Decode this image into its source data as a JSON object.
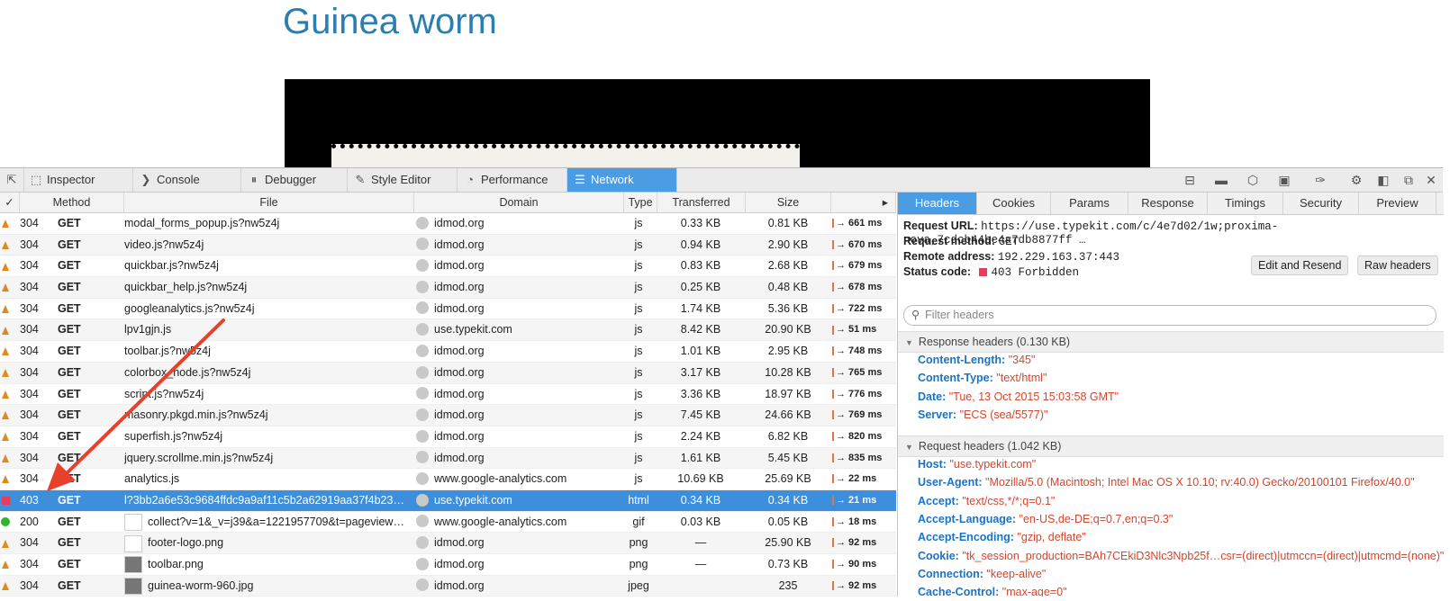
{
  "page": {
    "title": "Guinea worm"
  },
  "toolbar": {
    "tabs": [
      {
        "label": "Inspector",
        "icon": "inspector-icon",
        "glyph": "⬚"
      },
      {
        "label": "Console",
        "icon": "console-icon",
        "glyph": "❯"
      },
      {
        "label": "Debugger",
        "icon": "debugger-icon",
        "glyph": "⏸"
      },
      {
        "label": "Style Editor",
        "icon": "style-editor-icon",
        "glyph": "✎"
      },
      {
        "label": "Performance",
        "icon": "performance-icon",
        "glyph": "◔"
      },
      {
        "label": "Network",
        "icon": "network-icon",
        "glyph": "☰"
      }
    ],
    "active_tab": "Network"
  },
  "list": {
    "columns": {
      "check": "✓",
      "method": "Method",
      "file": "File",
      "domain": "Domain",
      "type": "Type",
      "transferred": "Transferred",
      "size": "Size"
    },
    "rows": [
      {
        "status": "304",
        "icon": "warn",
        "method": "GET",
        "file": "modal_forms_popup.js?nw5z4j",
        "domain": "idmod.org",
        "type": "js",
        "transferred": "0.33 KB",
        "size": "0.81 KB",
        "time": "→ 661 ms"
      },
      {
        "status": "304",
        "icon": "warn",
        "method": "GET",
        "file": "video.js?nw5z4j",
        "domain": "idmod.org",
        "type": "js",
        "transferred": "0.94 KB",
        "size": "2.90 KB",
        "time": "→ 670 ms"
      },
      {
        "status": "304",
        "icon": "warn",
        "method": "GET",
        "file": "quickbar.js?nw5z4j",
        "domain": "idmod.org",
        "type": "js",
        "transferred": "0.83 KB",
        "size": "2.68 KB",
        "time": "→ 679 ms"
      },
      {
        "status": "304",
        "icon": "warn",
        "method": "GET",
        "file": "quickbar_help.js?nw5z4j",
        "domain": "idmod.org",
        "type": "js",
        "transferred": "0.25 KB",
        "size": "0.48 KB",
        "time": "→ 678 ms"
      },
      {
        "status": "304",
        "icon": "warn",
        "method": "GET",
        "file": "googleanalytics.js?nw5z4j",
        "domain": "idmod.org",
        "type": "js",
        "transferred": "1.74 KB",
        "size": "5.36 KB",
        "time": "→ 722 ms"
      },
      {
        "status": "304",
        "icon": "warn",
        "method": "GET",
        "file": "lpv1gjn.js",
        "domain": "use.typekit.com",
        "type": "js",
        "transferred": "8.42 KB",
        "size": "20.90 KB",
        "time": "→ 51 ms"
      },
      {
        "status": "304",
        "icon": "warn",
        "method": "GET",
        "file": "toolbar.js?nw5z4j",
        "domain": "idmod.org",
        "type": "js",
        "transferred": "1.01 KB",
        "size": "2.95 KB",
        "time": "→ 748 ms"
      },
      {
        "status": "304",
        "icon": "warn",
        "method": "GET",
        "file": "colorbox_node.js?nw5z4j",
        "domain": "idmod.org",
        "type": "js",
        "transferred": "3.17 KB",
        "size": "10.28 KB",
        "time": "→ 765 ms"
      },
      {
        "status": "304",
        "icon": "warn",
        "method": "GET",
        "file": "script.js?nw5z4j",
        "domain": "idmod.org",
        "type": "js",
        "transferred": "3.36 KB",
        "size": "18.97 KB",
        "time": "→ 776 ms"
      },
      {
        "status": "304",
        "icon": "warn",
        "method": "GET",
        "file": "masonry.pkgd.min.js?nw5z4j",
        "domain": "idmod.org",
        "type": "js",
        "transferred": "7.45 KB",
        "size": "24.66 KB",
        "time": "→ 769 ms"
      },
      {
        "status": "304",
        "icon": "warn",
        "method": "GET",
        "file": "superfish.js?nw5z4j",
        "domain": "idmod.org",
        "type": "js",
        "transferred": "2.24 KB",
        "size": "6.82 KB",
        "time": "→ 820 ms"
      },
      {
        "status": "304",
        "icon": "warn",
        "method": "GET",
        "file": "jquery.scrollme.min.js?nw5z4j",
        "domain": "idmod.org",
        "type": "js",
        "transferred": "1.61 KB",
        "size": "5.45 KB",
        "time": "→ 835 ms"
      },
      {
        "status": "304",
        "icon": "warn",
        "method": "GET",
        "file": "analytics.js",
        "domain": "www.google-analytics.com",
        "type": "js",
        "transferred": "10.69 KB",
        "size": "25.69 KB",
        "time": "→ 22 ms"
      },
      {
        "status": "403",
        "icon": "error",
        "method": "GET",
        "file": "l?3bb2a6e53c9684ffdc9a9af11c5b2a62919aa37f4b23…",
        "domain": "use.typekit.com",
        "type": "html",
        "transferred": "0.34 KB",
        "size": "0.34 KB",
        "time": "→ 21 ms",
        "selected": true
      },
      {
        "status": "200",
        "icon": "ok",
        "method": "GET",
        "file": "collect?v=1&_v=j39&a=1221957709&t=pageview&_…",
        "domain": "www.google-analytics.com",
        "type": "gif",
        "transferred": "0.03 KB",
        "size": "0.05 KB",
        "time": "→ 18 ms",
        "thumb": "light"
      },
      {
        "status": "304",
        "icon": "warn",
        "method": "GET",
        "file": "footer-logo.png",
        "domain": "idmod.org",
        "type": "png",
        "transferred": "—",
        "size": "25.90 KB",
        "time": "→ 92 ms",
        "thumb": "light"
      },
      {
        "status": "304",
        "icon": "warn",
        "method": "GET",
        "file": "toolbar.png",
        "domain": "idmod.org",
        "type": "png",
        "transferred": "—",
        "size": "0.73 KB",
        "time": "→ 90 ms",
        "thumb": "dark"
      },
      {
        "status": "304",
        "icon": "warn",
        "method": "GET",
        "file": "guinea-worm-960.jpg",
        "domain": "idmod.org",
        "type": "jpeg",
        "transferred": "",
        "size": "235",
        "time": "→ 92 ms",
        "thumb": "dark"
      }
    ]
  },
  "details": {
    "tabs": [
      "Headers",
      "Cookies",
      "Params",
      "Response",
      "Timings",
      "Security",
      "Preview"
    ],
    "active_tab": "Headers",
    "request_url_label": "Request URL:",
    "request_url": "https://use.typekit.com/c/4e7d02/1w;proxima-nova,7cdcb44be4a7db8877ff …",
    "method_label": "Request method:",
    "method": "GET",
    "remote_label": "Remote address:",
    "remote": "192.229.163.37:443",
    "status_label": "Status code:",
    "status": "403 Forbidden",
    "status_color": "#e53d5a",
    "edit_resend": "Edit and Resend",
    "raw_headers": "Raw headers",
    "filter_placeholder": "Filter headers",
    "response_section": "Response headers (0.130 KB)",
    "response_headers": [
      {
        "k": "Content-Length:",
        "v": "\"345\""
      },
      {
        "k": "Content-Type:",
        "v": "\"text/html\""
      },
      {
        "k": "Date:",
        "v": "\"Tue, 13 Oct 2015 15:03:58 GMT\""
      },
      {
        "k": "Server:",
        "v": "\"ECS (sea/5577)\""
      }
    ],
    "request_section": "Request headers (1.042 KB)",
    "request_headers": [
      {
        "k": "Host:",
        "v": "\"use.typekit.com\""
      },
      {
        "k": "User-Agent:",
        "v": "\"Mozilla/5.0 (Macintosh; Intel Mac OS X 10.10; rv:40.0) Gecko/20100101 Firefox/40.0\""
      },
      {
        "k": "Accept:",
        "v": "\"text/css,*/*;q=0.1\""
      },
      {
        "k": "Accept-Language:",
        "v": "\"en-US,de-DE;q=0.7,en;q=0.3\""
      },
      {
        "k": "Accept-Encoding:",
        "v": "\"gzip, deflate\""
      },
      {
        "k": "Cookie:",
        "v": "\"tk_session_production=BAh7CEkiD3Nlc3Npb25f…csr=(direct)|utmccn=(direct)|utmcmd=(none)\""
      },
      {
        "k": "Connection:",
        "v": "\"keep-alive\""
      },
      {
        "k": "Cache-Control:",
        "v": "\"max-age=0\""
      }
    ]
  },
  "colors": {
    "accent": "#4a9de3",
    "selected_row": "#3d8fdb",
    "header_key": "#1a73c6",
    "header_value": "#d6452d",
    "warn": "#e08a1e",
    "ok": "#2bb62b",
    "annotation_arrow": "#e8402a"
  }
}
